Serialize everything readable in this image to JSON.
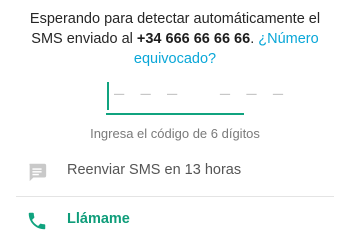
{
  "verification": {
    "message_prefix": "Esperando para detectar automáticamente el SMS enviado al ",
    "phone_number": "+34 666 66 66 66",
    "message_suffix": ". ",
    "wrong_number_link": "¿Número equivocado?"
  },
  "code_input": {
    "placeholder": "– – –   – – –",
    "hint": "Ingresa el código de 6 dígitos"
  },
  "actions": {
    "resend_sms": {
      "label": "Reenviar SMS en 13 horas",
      "icon": "message-icon"
    },
    "call_me": {
      "label": "Llámame",
      "icon": "phone-icon"
    }
  },
  "colors": {
    "accent": "#10a37f",
    "link": "#0aa7d8",
    "muted_icon": "#c9c9c9"
  }
}
